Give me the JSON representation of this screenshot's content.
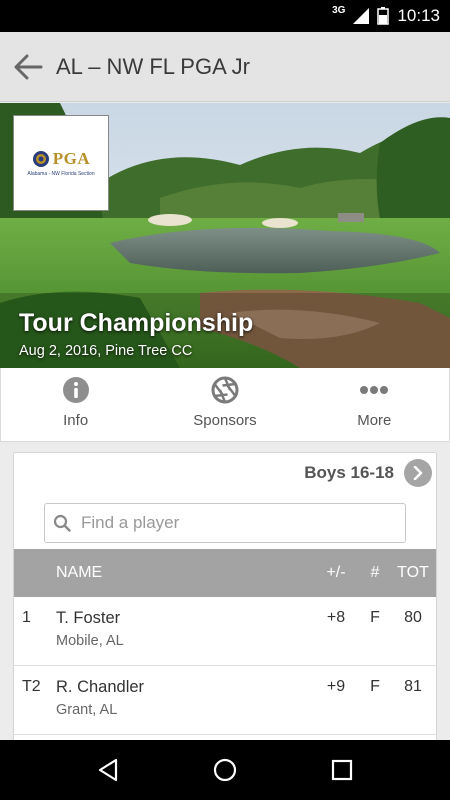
{
  "status_bar": {
    "network": "3G",
    "time": "10:13"
  },
  "app_bar": {
    "title": "AL – NW FL PGA Jr"
  },
  "hero": {
    "logo": {
      "word": "PGA",
      "subtitle": "Alabama - NW Florida Section"
    },
    "event_title": "Tour Championship",
    "event_subtitle": "Aug 2, 2016, Pine Tree CC"
  },
  "tabs": [
    {
      "label": "Info",
      "icon": "info-icon"
    },
    {
      "label": "Sponsors",
      "icon": "aperture-icon"
    },
    {
      "label": "More",
      "icon": "more-dots-icon"
    }
  ],
  "leaderboard": {
    "division": "Boys 16-18",
    "search_placeholder": "Find a player",
    "columns": {
      "name": "NAME",
      "diff": "+/-",
      "hole": "#",
      "total": "TOT"
    },
    "rows": [
      {
        "pos": "1",
        "name": "T. Foster",
        "city": "Mobile, AL",
        "diff": "+8",
        "hole": "F",
        "total": "80"
      },
      {
        "pos": "T2",
        "name": "R. Chandler",
        "city": "Grant, AL",
        "diff": "+9",
        "hole": "F",
        "total": "81"
      }
    ]
  },
  "colors": {
    "accent_gold": "#b8902a",
    "header_gray": "#a3a3a3",
    "app_bar": "#e4e4e4"
  }
}
